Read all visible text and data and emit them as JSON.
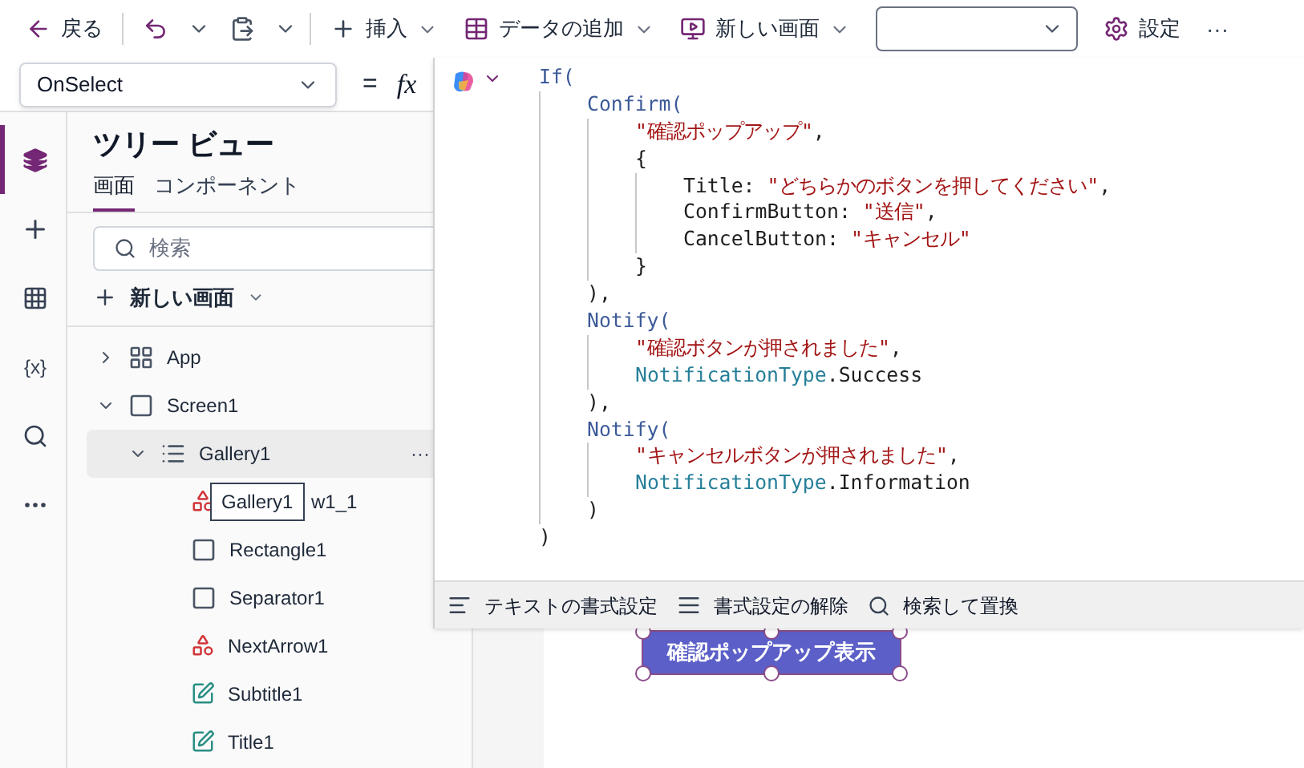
{
  "toolbar": [
    {
      "kind": "back",
      "label": "戻る"
    },
    {
      "kind": "sep"
    },
    {
      "kind": "undo"
    },
    {
      "kind": "chevron"
    },
    {
      "kind": "paste"
    },
    {
      "kind": "chevron"
    },
    {
      "kind": "sep"
    },
    {
      "kind": "insert",
      "label": "挿入"
    },
    {
      "kind": "data",
      "label": "データの追加"
    },
    {
      "kind": "screen",
      "label": "新しい画面"
    },
    {
      "kind": "select"
    },
    {
      "kind": "settings",
      "label": "設定"
    },
    {
      "kind": "more",
      "label": "···"
    }
  ],
  "formula_bar": {
    "property": "OnSelect",
    "equals": "=",
    "fx": "fx"
  },
  "rail": [
    {
      "kind": "layers",
      "selected": true
    },
    {
      "kind": "plus",
      "selected": false
    },
    {
      "kind": "table",
      "selected": false
    },
    {
      "kind": "variables",
      "label": "{x}",
      "selected": false
    },
    {
      "kind": "search",
      "selected": false
    },
    {
      "kind": "more",
      "selected": false
    }
  ],
  "tree": {
    "title": "ツリー ビュー",
    "tabs": [
      {
        "label": "画面",
        "selected": true
      },
      {
        "label": "コンポーネント",
        "selected": false
      }
    ],
    "search_placeholder": "検索",
    "new_screen": "新しい画面",
    "items": [
      {
        "kind": "app",
        "label": "App",
        "expanded": false,
        "selected": false
      },
      {
        "kind": "screen",
        "label": "Screen1",
        "expanded": true,
        "selected": false,
        "children": [
          {
            "kind": "gallery",
            "label": "Gallery1",
            "expanded": true,
            "selected": true,
            "more": "···",
            "children": [
              {
                "kind": "icon",
                "label": "w1_1",
                "tooltip": "Gallery1"
              },
              {
                "kind": "rect",
                "label": "Rectangle1"
              },
              {
                "kind": "rect",
                "label": "Separator1"
              },
              {
                "kind": "icon",
                "label": "NextArrow1"
              },
              {
                "kind": "text",
                "label": "Subtitle1"
              },
              {
                "kind": "text",
                "label": "Title1"
              }
            ]
          }
        ]
      }
    ]
  },
  "code": [
    {
      "tokens": [
        {
          "kind": "fn",
          "text": "If("
        }
      ],
      "children": [
        {
          "tokens": [
            {
              "kind": "fn",
              "text": "Confirm("
            }
          ],
          "children": [
            {
              "tokens": [
                {
                  "kind": "str",
                  "text": "\"確認ポップアップ\""
                },
                {
                  "kind": "plain",
                  "text": ","
                }
              ]
            },
            {
              "tokens": [
                {
                  "kind": "plain",
                  "text": "{"
                }
              ],
              "children": [
                {
                  "tokens": [
                    {
                      "kind": "plain",
                      "text": "Title: "
                    },
                    {
                      "kind": "str",
                      "text": "\"どちらかのボタンを押してください\""
                    },
                    {
                      "kind": "plain",
                      "text": ","
                    }
                  ]
                },
                {
                  "tokens": [
                    {
                      "kind": "plain",
                      "text": "ConfirmButton: "
                    },
                    {
                      "kind": "str",
                      "text": "\"送信\""
                    },
                    {
                      "kind": "plain",
                      "text": ","
                    }
                  ]
                },
                {
                  "tokens": [
                    {
                      "kind": "plain",
                      "text": "CancelButton: "
                    },
                    {
                      "kind": "str",
                      "text": "\"キャンセル\""
                    }
                  ]
                }
              ]
            },
            {
              "tokens": [
                {
                  "kind": "plain",
                  "text": "}"
                }
              ]
            }
          ]
        },
        {
          "tokens": [
            {
              "kind": "plain",
              "text": "),"
            }
          ]
        },
        {
          "tokens": [
            {
              "kind": "fn",
              "text": "Notify("
            }
          ],
          "children": [
            {
              "tokens": [
                {
                  "kind": "str",
                  "text": "\"確認ボタンが押されました\""
                },
                {
                  "kind": "plain",
                  "text": ","
                }
              ]
            },
            {
              "tokens": [
                {
                  "kind": "enum",
                  "text": "NotificationType"
                },
                {
                  "kind": "plain",
                  "text": ".Success"
                }
              ]
            }
          ]
        },
        {
          "tokens": [
            {
              "kind": "plain",
              "text": "),"
            }
          ]
        },
        {
          "tokens": [
            {
              "kind": "fn",
              "text": "Notify("
            }
          ],
          "children": [
            {
              "tokens": [
                {
                  "kind": "str",
                  "text": "\"キャンセルボタンが押されました\""
                },
                {
                  "kind": "plain",
                  "text": ","
                }
              ]
            },
            {
              "tokens": [
                {
                  "kind": "enum",
                  "text": "NotificationType"
                },
                {
                  "kind": "plain",
                  "text": ".Information"
                }
              ]
            }
          ]
        },
        {
          "tokens": [
            {
              "kind": "plain",
              "text": ")"
            }
          ]
        }
      ]
    },
    {
      "tokens": [
        {
          "kind": "plain",
          "text": ")"
        }
      ]
    }
  ],
  "editor_toolbar": [
    {
      "kind": "format",
      "label": "テキストの書式設定"
    },
    {
      "kind": "clear",
      "label": "書式設定の解除"
    },
    {
      "kind": "find",
      "label": "検索して置換"
    }
  ],
  "canvas_button": {
    "label": "確認ポップアップ表示",
    "selected": true
  }
}
